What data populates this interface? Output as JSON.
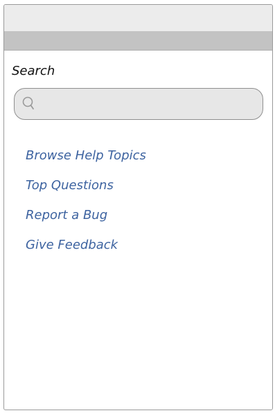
{
  "search": {
    "label": "Search",
    "placeholder": "",
    "icon": "search-icon"
  },
  "links": [
    {
      "label": "Browse Help Topics"
    },
    {
      "label": "Top Questions"
    },
    {
      "label": "Report a Bug"
    },
    {
      "label": "Give Feedback"
    }
  ],
  "colors": {
    "link": "#3d63a0",
    "nav_bar": "#c3c3c3",
    "search_field": "#e7e7e7"
  }
}
